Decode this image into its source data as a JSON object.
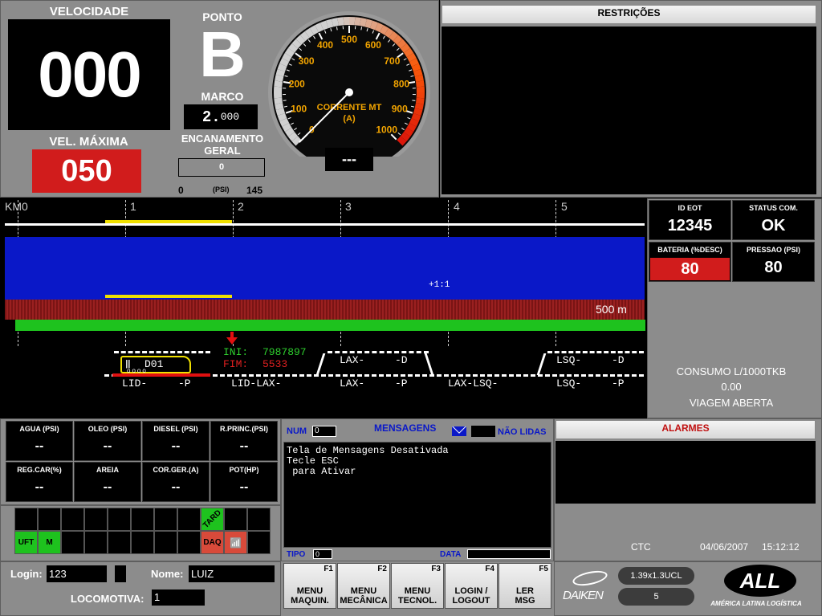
{
  "speed": {
    "title": "VELOCIDADE",
    "value": "000",
    "max_title": "VEL. MÁXIMA",
    "max_value": "050"
  },
  "ponto": {
    "title": "PONTO",
    "letter": "B",
    "marco_title": "MARCO",
    "marco_int": "2.",
    "marco_frac": "000"
  },
  "encanamento": {
    "title": "ENCANAMENTO\nGERAL",
    "value": "0",
    "min": "0",
    "unit": "(PSI)",
    "max": "145",
    "level": 0
  },
  "gauge": {
    "label": "CORRENTE MT\n(A)",
    "ticks": [
      "0",
      "100",
      "200",
      "300",
      "400",
      "500",
      "600",
      "700",
      "800",
      "900",
      "1000"
    ],
    "needle": 0,
    "readout": "---"
  },
  "restricoes": {
    "title": "RESTRIÇÕES"
  },
  "track": {
    "km_labels": [
      "KM0",
      "1",
      "2",
      "3",
      "4",
      "5"
    ],
    "scale_text": "+1:1",
    "distance": "500 m",
    "train_id": "D01",
    "ini_label": "INI:",
    "ini_value": "7987897",
    "fim_label": "FIM:",
    "fim_value": "5533",
    "upper_labels": [
      "LAX-",
      "-D",
      "LSQ-",
      "-D"
    ],
    "lower_labels": [
      "LID-",
      "-P",
      "LID-LAX-",
      "LAX-",
      "-P",
      "LAX-LSQ-",
      "LSQ-",
      "-P"
    ]
  },
  "eot": {
    "id_title": "ID EOT",
    "id_value": "12345",
    "status_title": "STATUS COM.",
    "status_value": "OK",
    "bateria_title": "BATERIA (%DESC)",
    "bateria_value": "80",
    "pressao_title": "PRESSAO (PSI)",
    "pressao_value": "80",
    "consumo_title": "CONSUMO L/1000TKB",
    "consumo_value": "0.00",
    "viagem": "VIAGEM ABERTA"
  },
  "sensors": [
    {
      "label": "AGUA (PSI)",
      "value": "--"
    },
    {
      "label": "OLEO (PSI)",
      "value": "--"
    },
    {
      "label": "DIESEL (PSI)",
      "value": "--"
    },
    {
      "label": "R.PRINC.(PSI)",
      "value": "--"
    },
    {
      "label": "REG.CAR(%)",
      "value": "--"
    },
    {
      "label": "AREIA",
      "value": "--"
    },
    {
      "label": "COR.GER.(A)",
      "value": "--"
    },
    {
      "label": "POT(HP)",
      "value": "--"
    }
  ],
  "status_grid": {
    "uft": "UFT",
    "m": "M",
    "tard": "TARD",
    "daq": "DAQ"
  },
  "messages": {
    "num_label": "NUM",
    "num_value": "0",
    "title": "MENSAGENS",
    "nao_lidas": "NÃO LIDAS",
    "body": "Tela de Mensagens Desativada\nTecle ESC\n para Ativar",
    "tipo_label": "TIPO",
    "tipo_value": "0",
    "data_label": "DATA"
  },
  "alarmes": {
    "title": "ALARMES",
    "ctc": "CTC",
    "date": "04/06/2007",
    "time": "15:12:12"
  },
  "login": {
    "login_label": "Login:",
    "login_value": "123",
    "nome_label": "Nome:",
    "nome_value": "LUIZ",
    "loco_label": "LOCOMOTIVA:",
    "loco_value": "1"
  },
  "fkeys": [
    {
      "fn": "F1",
      "label": "MENU\nMAQUIN."
    },
    {
      "fn": "F2",
      "label": "MENU\nMECÂNICA"
    },
    {
      "fn": "F3",
      "label": "MENU\nTECNOL."
    },
    {
      "fn": "F4",
      "label": "LOGIN /\nLOGOUT"
    },
    {
      "fn": "F5",
      "label": "LER\nMSG"
    }
  ],
  "brand": {
    "daiken": "DAIKEN",
    "all": "ALL",
    "all_sub": "AMÉRICA LATINA LOGÍSTICA",
    "pill1": "1.39x1.3UCL",
    "pill2": "5"
  },
  "colors": {
    "panel": "#8c8c8c",
    "red": "#d11c1c",
    "blue": "#0a18c8",
    "green": "#1ec21e"
  }
}
